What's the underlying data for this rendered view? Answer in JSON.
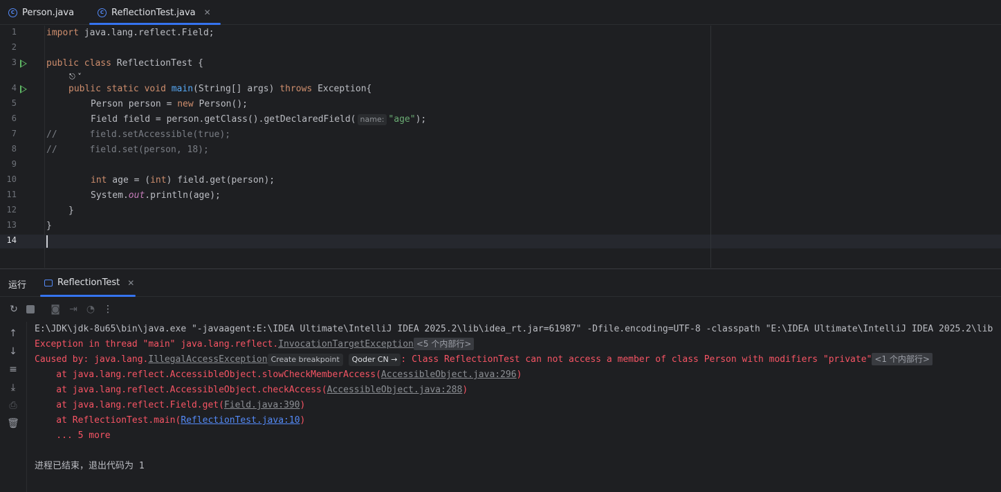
{
  "tabs": [
    {
      "label": "Person.java",
      "icon": "class-icon"
    },
    {
      "label": "ReflectionTest.java",
      "icon": "runnable-class-icon",
      "close": "✕"
    }
  ],
  "editor": {
    "line_numbers": [
      "1",
      "2",
      "3",
      "4",
      "5",
      "6",
      "7",
      "8",
      "9",
      "10",
      "11",
      "12",
      "13",
      "14"
    ],
    "lines": {
      "l1_kw": "import",
      "l1_rest": " java.lang.reflect.Field;",
      "l3_kw1": "public",
      "l3_kw2": "class",
      "l3_rest": " ReflectionTest {",
      "l4_kw1": "public",
      "l4_kw2": "static",
      "l4_kw3": "void",
      "l4_fn": "main",
      "l4_mid": "(String[] args) ",
      "l4_kw4": "throws",
      "l4_rest": " Exception{",
      "l5_a": "Person person = ",
      "l5_kw": "new",
      "l5_b": " Person();",
      "l6_a": "Field field = person.getClass().getDeclaredField(",
      "l6_hint": "name:",
      "l6_str": "\"age\"",
      "l6_b": ");",
      "l7": "//      field.setAccessible(true);",
      "l8": "//      field.set(person, 18);",
      "l10_kw": "int",
      "l10_a": " age = (",
      "l10_kw2": "int",
      "l10_b": ") field.get(person);",
      "l11_a": "System.",
      "l11_out": "out",
      "l11_b": ".println(age);",
      "l12": "}",
      "l13": "}"
    }
  },
  "run": {
    "title": "运行",
    "tab_label": "ReflectionTest",
    "tab_close": "✕",
    "console": {
      "cmd": "E:\\JDK\\jdk-8u65\\bin\\java.exe \"-javaagent:E:\\IDEA Ultimate\\IntelliJ IDEA 2025.2\\lib\\idea_rt.jar=61987\" -Dfile.encoding=UTF-8 -classpath \"E:\\IDEA Ultimate\\IntelliJ IDEA 2025.2\\lib",
      "exc_prefix": "Exception in thread \"main\" java.lang.reflect.",
      "exc_link": "InvocationTargetException",
      "exc_fold": "<5 个内部行>",
      "cause_prefix": "Caused by: java.lang.",
      "cause_link": "IllegalAccessException",
      "create_bp": "Create breakpoint",
      "qoder": "Qoder CN →",
      "cause_msg": ": Class ReflectionTest can not access a member of class Person with modifiers \"private\"",
      "cause_fold": "<1 个内部行>",
      "st1_a": "    at java.lang.reflect.AccessibleObject.slowCheckMemberAccess(",
      "st1_link": "AccessibleObject.java:296",
      "st1_b": ")",
      "st2_a": "    at java.lang.reflect.AccessibleObject.checkAccess(",
      "st2_link": "AccessibleObject.java:288",
      "st2_b": ")",
      "st3_a": "    at java.lang.reflect.Field.get(",
      "st3_link": "Field.java:390",
      "st3_b": ")",
      "st4_a": "    at ReflectionTest.main(",
      "st4_link": "ReflectionTest.java:10",
      "st4_b": ")",
      "more": "    ... 5 more",
      "exit": "进程已结束，退出代码为 1"
    }
  }
}
